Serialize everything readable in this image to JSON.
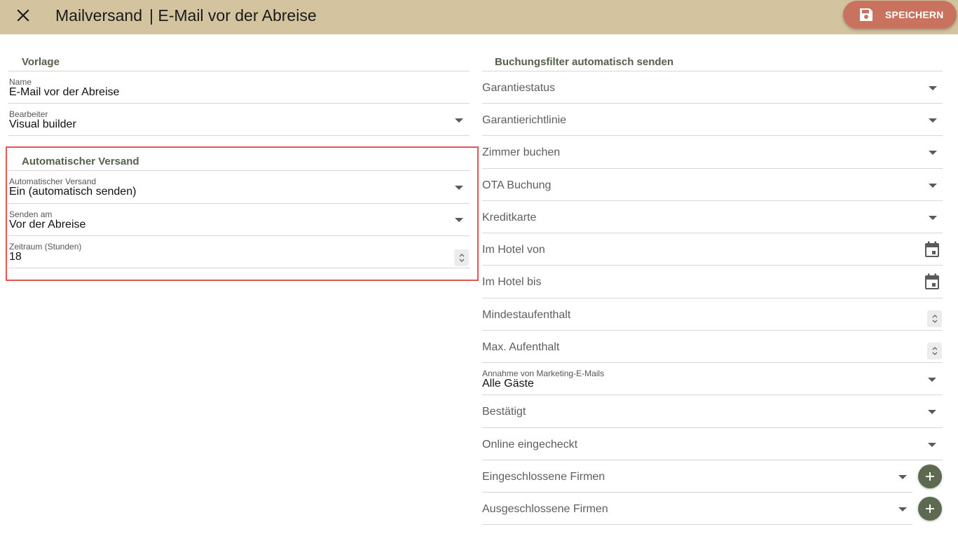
{
  "header": {
    "title": "Mailversand",
    "subtitle": "| E-Mail vor der Abreise",
    "save_label": "SPEICHERN"
  },
  "template_section": {
    "title": "Vorlage",
    "name_label": "Name",
    "name_value": "E-Mail vor der Abreise",
    "editor_label": "Bearbeiter",
    "editor_value": "Visual builder"
  },
  "auto_section": {
    "title": "Automatischer Versand",
    "auto_label": "Automatischer Versand",
    "auto_value": "Ein (automatisch senden)",
    "send_on_label": "Senden am",
    "send_on_value": "Vor der Abreise",
    "period_label": "Zeitraum (Stunden)",
    "period_value": "18"
  },
  "filter_section": {
    "title": "Buchungsfilter automatisch senden",
    "guarantee_status": "Garantiestatus",
    "guarantee_policy": "Garantierichtlinie",
    "book_rooms": "Zimmer buchen",
    "ota_booking": "OTA Buchung",
    "credit_card": "Kreditkarte",
    "in_hotel_from": "Im Hotel von",
    "in_hotel_to": "Im Hotel bis",
    "min_stay": "Mindestaufenthalt",
    "max_stay": "Max. Aufenthalt",
    "marketing_label": "Annahme von Marketing-E-Mails",
    "marketing_value": "Alle Gäste",
    "confirmed": "Bestätigt",
    "online_checked_in": "Online eingecheckt",
    "included_companies": "Eingeschlossene Firmen",
    "excluded_companies": "Ausgeschlossene Firmen"
  },
  "colors": {
    "header_bg": "#d3c49f",
    "save_button": "#c9735f",
    "section_title": "#55604a",
    "add_button": "#5d6a4f",
    "highlight_border": "#e45551"
  },
  "icons": [
    "close-icon",
    "save-icon",
    "dropdown-arrow-icon",
    "calendar-icon",
    "spinner-icon",
    "plus-icon"
  ]
}
